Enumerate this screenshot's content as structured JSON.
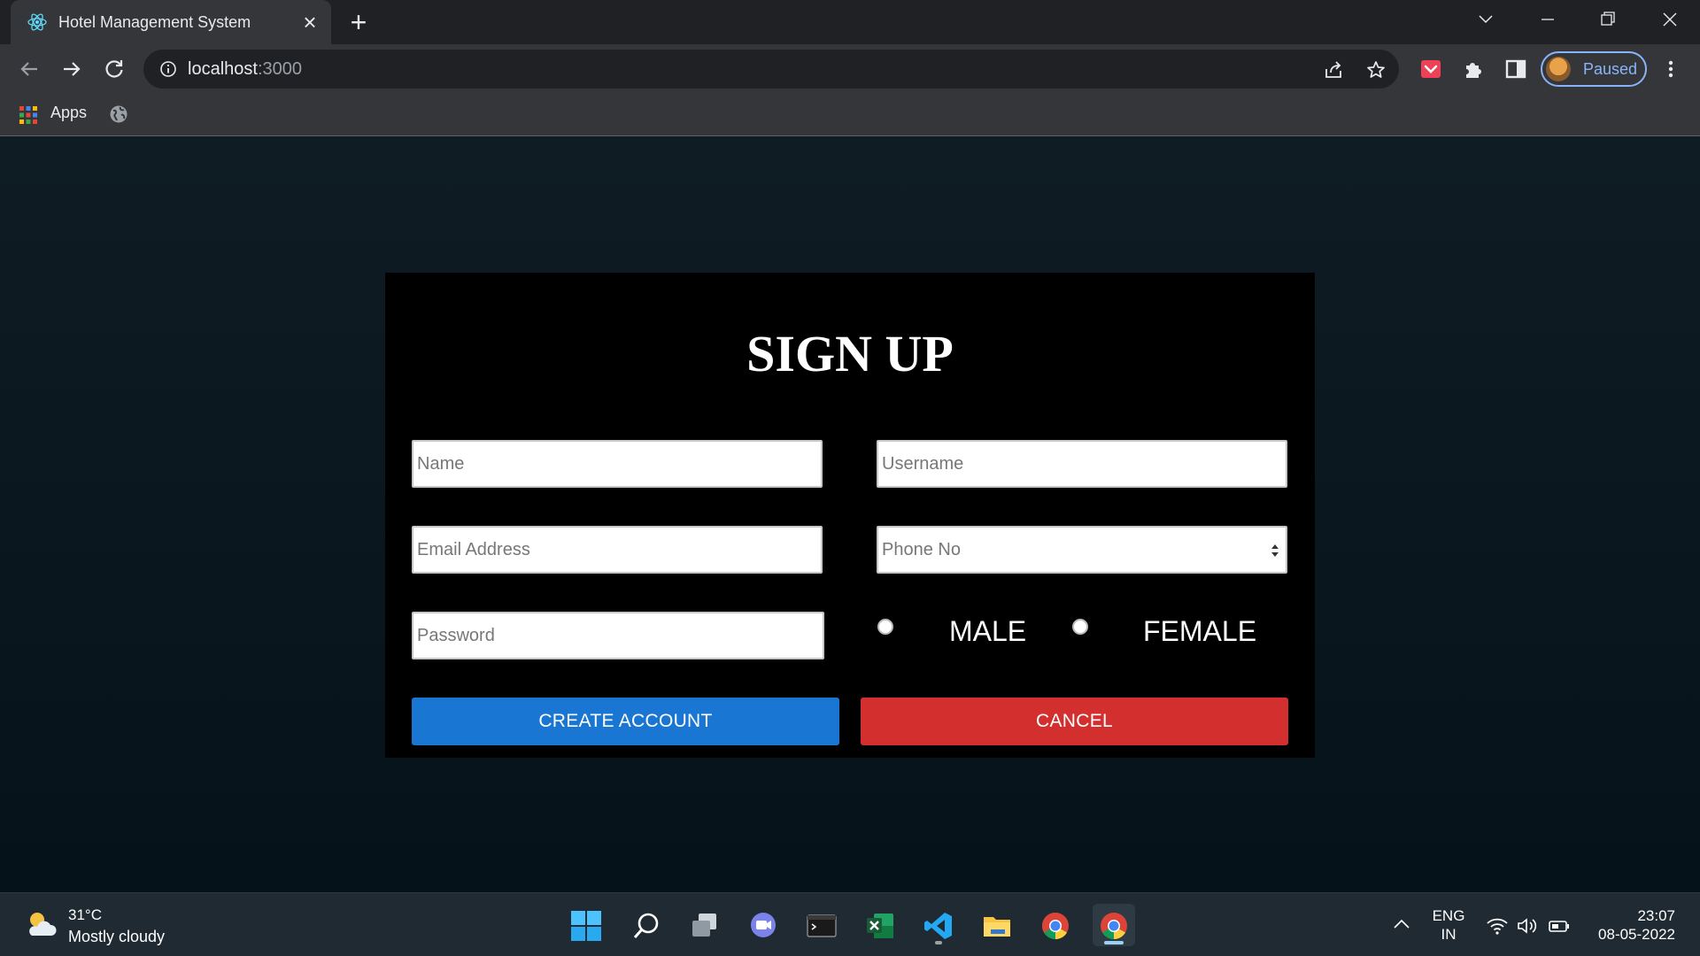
{
  "browser": {
    "tab": {
      "title": "Hotel Management System",
      "close_icon": "close-icon"
    },
    "new_tab_icon": "plus-icon",
    "address": {
      "host": "localhost",
      "port": ":3000"
    },
    "bookmarks": {
      "apps_label": "Apps"
    },
    "profile": {
      "label": "Paused"
    }
  },
  "signup": {
    "title": "SIGN UP",
    "fields": {
      "name": {
        "placeholder": "Name"
      },
      "username": {
        "placeholder": "Username"
      },
      "email": {
        "placeholder": "Email Address"
      },
      "phone": {
        "placeholder": "Phone No"
      },
      "password": {
        "placeholder": "Password"
      }
    },
    "gender": {
      "male": "MALE",
      "female": "FEMALE"
    },
    "buttons": {
      "create": "CREATE ACCOUNT",
      "cancel": "CANCEL"
    },
    "colors": {
      "create": "#1976d2",
      "cancel": "#d32f2f"
    }
  },
  "taskbar": {
    "weather": {
      "temp": "31°C",
      "desc": "Mostly cloudy"
    },
    "apps": [
      "windows-start",
      "search",
      "task-view",
      "chat",
      "terminal",
      "excel",
      "vscode",
      "file-explorer",
      "chrome",
      "chrome-active"
    ],
    "lang": {
      "line1": "ENG",
      "line2": "IN"
    },
    "clock": {
      "time": "23:07",
      "date": "08-05-2022"
    }
  }
}
